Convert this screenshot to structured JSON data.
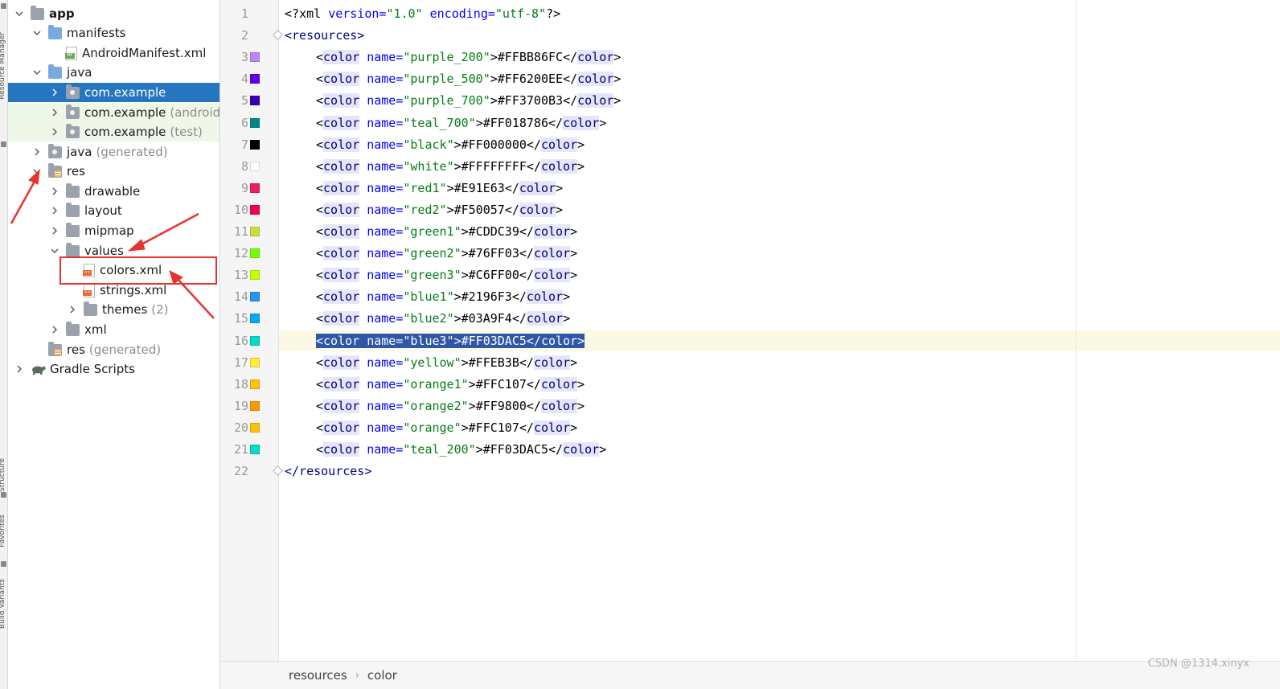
{
  "toolstrip": {
    "labels": [
      "Resource Manager",
      "Structure",
      "Favorites",
      "Build Variants"
    ]
  },
  "tree": {
    "items": [
      {
        "label": "app",
        "suffix": "",
        "icon": "module-folder-icon",
        "expanded": true
      },
      {
        "label": "manifests",
        "suffix": "",
        "icon": "folder-icon",
        "expanded": true
      },
      {
        "label": "AndroidManifest.xml",
        "suffix": "",
        "icon": "manifest-file-icon",
        "file_tag": "MF"
      },
      {
        "label": "java",
        "suffix": "",
        "icon": "folder-icon",
        "expanded": true
      },
      {
        "label": "com.example",
        "suffix": "",
        "icon": "package-icon",
        "selected": true
      },
      {
        "label": "com.example",
        "suffix": "(androidT",
        "icon": "package-icon"
      },
      {
        "label": "com.example",
        "suffix": "(test)",
        "icon": "package-icon"
      },
      {
        "label": "java",
        "suffix": "(generated)",
        "icon": "generated-folder-icon"
      },
      {
        "label": "res",
        "suffix": "",
        "icon": "res-folder-icon",
        "expanded": true
      },
      {
        "label": "drawable",
        "suffix": "",
        "icon": "folder-icon"
      },
      {
        "label": "layout",
        "suffix": "",
        "icon": "folder-icon"
      },
      {
        "label": "mipmap",
        "suffix": "",
        "icon": "folder-icon"
      },
      {
        "label": "values",
        "suffix": "",
        "icon": "folder-icon",
        "expanded": true
      },
      {
        "label": "colors.xml",
        "suffix": "",
        "icon": "xml-file-icon",
        "file_tag": "<>"
      },
      {
        "label": "strings.xml",
        "suffix": "",
        "icon": "xml-file-icon",
        "file_tag": "<>"
      },
      {
        "label": "themes",
        "suffix": "(2)",
        "icon": "folder-icon"
      },
      {
        "label": "xml",
        "suffix": "",
        "icon": "folder-icon"
      },
      {
        "label": "res",
        "suffix": "(generated)",
        "icon": "res-folder-icon"
      },
      {
        "label": "Gradle Scripts",
        "suffix": "",
        "icon": "gradle-icon"
      }
    ]
  },
  "editor": {
    "lines": [
      {
        "n": "1",
        "swatch": ""
      },
      {
        "n": "2",
        "swatch": ""
      },
      {
        "n": "3",
        "swatch": "#BB86FC"
      },
      {
        "n": "4",
        "swatch": "#6200EE"
      },
      {
        "n": "5",
        "swatch": "#3700B3"
      },
      {
        "n": "6",
        "swatch": "#018786"
      },
      {
        "n": "7",
        "swatch": "#000000"
      },
      {
        "n": "8",
        "swatch": "#FFFFFF"
      },
      {
        "n": "9",
        "swatch": "#E91E63"
      },
      {
        "n": "10",
        "swatch": "#F50057"
      },
      {
        "n": "11",
        "swatch": "#CDDC39"
      },
      {
        "n": "12",
        "swatch": "#76FF03"
      },
      {
        "n": "13",
        "swatch": "#C6FF00"
      },
      {
        "n": "14",
        "swatch": "#2196F3"
      },
      {
        "n": "15",
        "swatch": "#03A9F4"
      },
      {
        "n": "16",
        "swatch": "#03DAC5"
      },
      {
        "n": "17",
        "swatch": "#FFEB3B"
      },
      {
        "n": "18",
        "swatch": "#FFC107"
      },
      {
        "n": "19",
        "swatch": "#FF9800"
      },
      {
        "n": "20",
        "swatch": "#FFC107"
      },
      {
        "n": "21",
        "swatch": "#03DAC5"
      },
      {
        "n": "22",
        "swatch": ""
      }
    ],
    "xml_decl": {
      "open": "<?xml ",
      "version_attr": "version=",
      "version_val": "\"1.0\"",
      "enc_attr": " encoding=",
      "enc_val": "\"utf-8\"",
      "close": "?>"
    },
    "resources_open": "<resources>",
    "resources_close": "</resources>",
    "colors": [
      {
        "name": "purple_200",
        "value": "#FFBB86FC"
      },
      {
        "name": "purple_500",
        "value": "#FF6200EE"
      },
      {
        "name": "purple_700",
        "value": "#FF3700B3"
      },
      {
        "name": "teal_700",
        "value": "#FF018786"
      },
      {
        "name": "black",
        "value": "#FF000000"
      },
      {
        "name": "white",
        "value": "#FFFFFFFF"
      },
      {
        "name": "red1",
        "value": "#E91E63"
      },
      {
        "name": "red2",
        "value": "#F50057"
      },
      {
        "name": "green1",
        "value": "#CDDC39"
      },
      {
        "name": "green2",
        "value": "#76FF03"
      },
      {
        "name": "green3",
        "value": "#C6FF00"
      },
      {
        "name": "blue1",
        "value": "#2196F3"
      },
      {
        "name": "blue2",
        "value": "#03A9F4"
      },
      {
        "name": "blue3",
        "value": "#FF03DAC5"
      },
      {
        "name": "yellow",
        "value": "#FFEB3B"
      },
      {
        "name": "orange1",
        "value": "#FFC107"
      },
      {
        "name": "orange2",
        "value": "#FF9800"
      },
      {
        "name": "orange",
        "value": "#FFC107"
      },
      {
        "name": "teal_200",
        "value": "#FF03DAC5"
      }
    ],
    "tag": {
      "open": "<",
      "name": "color",
      "attr": " name=",
      "gt": ">",
      "close_open": "</"
    },
    "selected_line": "16"
  },
  "breadcrumb": {
    "items": [
      "resources",
      "color"
    ],
    "separator": "›"
  },
  "watermark": "CSDN @1314.xinyx",
  "colors": {
    "selection": "#2675bf",
    "annotation": "#e8322f",
    "current_line": "#fbf8e5"
  }
}
